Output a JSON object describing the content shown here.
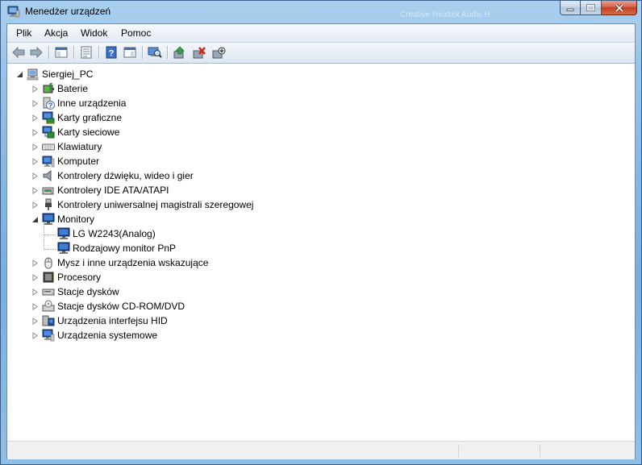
{
  "window": {
    "title": "Menedżer urządzeń",
    "background_ghost_title": "Creative Realtek Audio H"
  },
  "menu": [
    "Plik",
    "Akcja",
    "Widok",
    "Pomoc"
  ],
  "toolbar": [
    "back-arrow-icon",
    "forward-arrow-icon",
    "show-hide-console-tree-icon",
    "properties-icon",
    "help-icon",
    "scan-hardware-icon",
    "update-driver-icon",
    "uninstall-icon",
    "disable-device-icon"
  ],
  "tree": {
    "root": "Siergiej_PC",
    "categories": [
      {
        "label": "Baterie",
        "icon": "battery-icon",
        "expanded": false
      },
      {
        "label": "Inne urządzenia",
        "icon": "unknown-device-icon",
        "expanded": false
      },
      {
        "label": "Karty graficzne",
        "icon": "display-adapter-icon",
        "expanded": false
      },
      {
        "label": "Karty sieciowe",
        "icon": "network-adapter-icon",
        "expanded": false
      },
      {
        "label": "Klawiatury",
        "icon": "keyboard-icon",
        "expanded": false
      },
      {
        "label": "Komputer",
        "icon": "computer-icon",
        "expanded": false
      },
      {
        "label": "Kontrolery dźwięku, wideo i gier",
        "icon": "speaker-icon",
        "expanded": false
      },
      {
        "label": "Kontrolery IDE ATA/ATAPI",
        "icon": "ide-controller-icon",
        "expanded": false
      },
      {
        "label": "Kontrolery uniwersalnej magistrali szeregowej",
        "icon": "usb-icon",
        "expanded": false
      },
      {
        "label": "Monitory",
        "icon": "monitor-icon",
        "expanded": true,
        "children": [
          {
            "label": "LG W2243(Analog)",
            "icon": "monitor-icon"
          },
          {
            "label": "Rodzajowy monitor PnP",
            "icon": "monitor-icon"
          }
        ]
      },
      {
        "label": "Mysz i inne urządzenia wskazujące",
        "icon": "mouse-icon",
        "expanded": false
      },
      {
        "label": "Procesory",
        "icon": "processor-icon",
        "expanded": false
      },
      {
        "label": "Stacje dysków",
        "icon": "disk-drive-icon",
        "expanded": false
      },
      {
        "label": "Stacje dysków CD-ROM/DVD",
        "icon": "cdrom-icon",
        "expanded": false
      },
      {
        "label": "Urządzenia interfejsu HID",
        "icon": "hid-icon",
        "expanded": false
      },
      {
        "label": "Urządzenia systemowe",
        "icon": "system-device-icon",
        "expanded": false
      }
    ]
  }
}
